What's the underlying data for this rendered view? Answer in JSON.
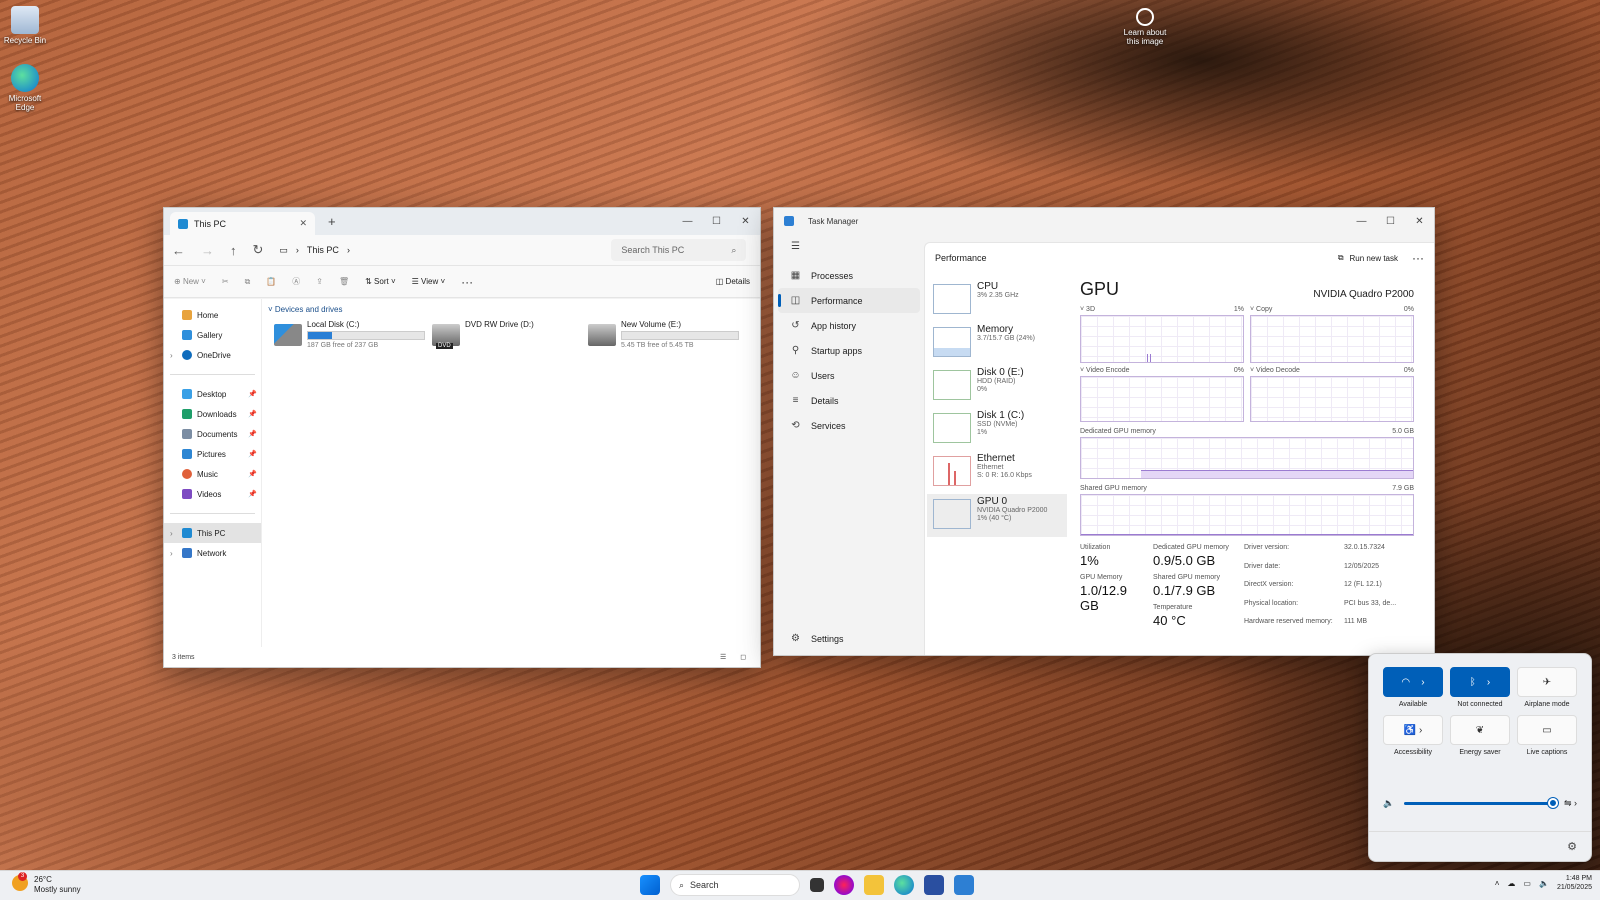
{
  "desktop": {
    "recycle": "Recycle Bin",
    "edge": "Microsoft Edge",
    "learn": "Learn about this image"
  },
  "explorer": {
    "tab_title": "This PC",
    "address": "This PC",
    "search_placeholder": "Search This PC",
    "cmd": {
      "new": "New",
      "sort": "Sort",
      "view": "View",
      "details": "Details"
    },
    "sidebar": [
      "Home",
      "Gallery",
      "OneDrive",
      "Desktop",
      "Downloads",
      "Documents",
      "Pictures",
      "Music",
      "Videos",
      "This PC",
      "Network"
    ],
    "group": "Devices and drives",
    "drives": [
      {
        "name": "Local Disk (C:)",
        "free": "187 GB free of 237 GB",
        "used": 0.21
      },
      {
        "name": "DVD RW Drive (D:)",
        "badge": "DVD"
      },
      {
        "name": "New Volume (E:)",
        "free": "5.45 TB free of 5.45 TB",
        "used": 0.0
      }
    ],
    "status": "3 items"
  },
  "taskmgr": {
    "title": "Task Manager",
    "nav": [
      "Processes",
      "Performance",
      "App history",
      "Startup apps",
      "Users",
      "Details",
      "Services",
      "Settings"
    ],
    "panel_title": "Performance",
    "run": "Run new task",
    "list": [
      {
        "name": "CPU",
        "sub1": "3% 2.35 GHz",
        "sub2": ""
      },
      {
        "name": "Memory",
        "sub1": "3.7/15.7 GB (24%)",
        "sub2": ""
      },
      {
        "name": "Disk 0 (E:)",
        "sub1": "HDD (RAID)",
        "sub2": "0%"
      },
      {
        "name": "Disk 1 (C:)",
        "sub1": "SSD (NVMe)",
        "sub2": "1%"
      },
      {
        "name": "Ethernet",
        "sub1": "Ethernet",
        "sub2": "S: 0 R: 16.0 Kbps"
      },
      {
        "name": "GPU 0",
        "sub1": "NVIDIA Quadro P2000",
        "sub2": "1% (40 °C)"
      }
    ],
    "gpu": {
      "title": "GPU",
      "model": "NVIDIA Quadro P2000",
      "g3d": "3D",
      "g3d_v": "1%",
      "copy": "Copy",
      "copy_v": "0%",
      "enc": "Video Encode",
      "enc_v": "0%",
      "dec": "Video Decode",
      "dec_v": "0%",
      "ded": "Dedicated GPU memory",
      "ded_max": "5.0 GB",
      "shr": "Shared GPU memory",
      "shr_max": "7.9 GB",
      "util_l": "Utilization",
      "util": "1%",
      "dedm_l": "Dedicated GPU memory",
      "dedm": "0.9/5.0 GB",
      "gmem_l": "GPU Memory",
      "gmem": "1.0/12.9 GB",
      "shm_l": "Shared GPU memory",
      "shm": "0.1/7.9 GB",
      "temp_l": "Temperature",
      "temp": "40 °C",
      "info": [
        [
          "Driver version:",
          "32.0.15.7324"
        ],
        [
          "Driver date:",
          "12/05/2025"
        ],
        [
          "DirectX version:",
          "12 (FL 12.1)"
        ],
        [
          "Physical location:",
          "PCI bus 33, de..."
        ],
        [
          "Hardware reserved memory:",
          "111 MB"
        ]
      ]
    }
  },
  "quick": {
    "tiles": [
      [
        "Available",
        true
      ],
      [
        "Not connected",
        true
      ],
      [
        "Airplane mode",
        false
      ],
      [
        "Accessibility",
        false
      ],
      [
        "Energy saver",
        false
      ],
      [
        "Live captions",
        false
      ]
    ],
    "volume": 0.96
  },
  "taskbar": {
    "temp": "26°C",
    "cond": "Mostly sunny",
    "badge": "3",
    "search": "Search",
    "time": "1:48 PM",
    "date": "21/05/2025"
  }
}
